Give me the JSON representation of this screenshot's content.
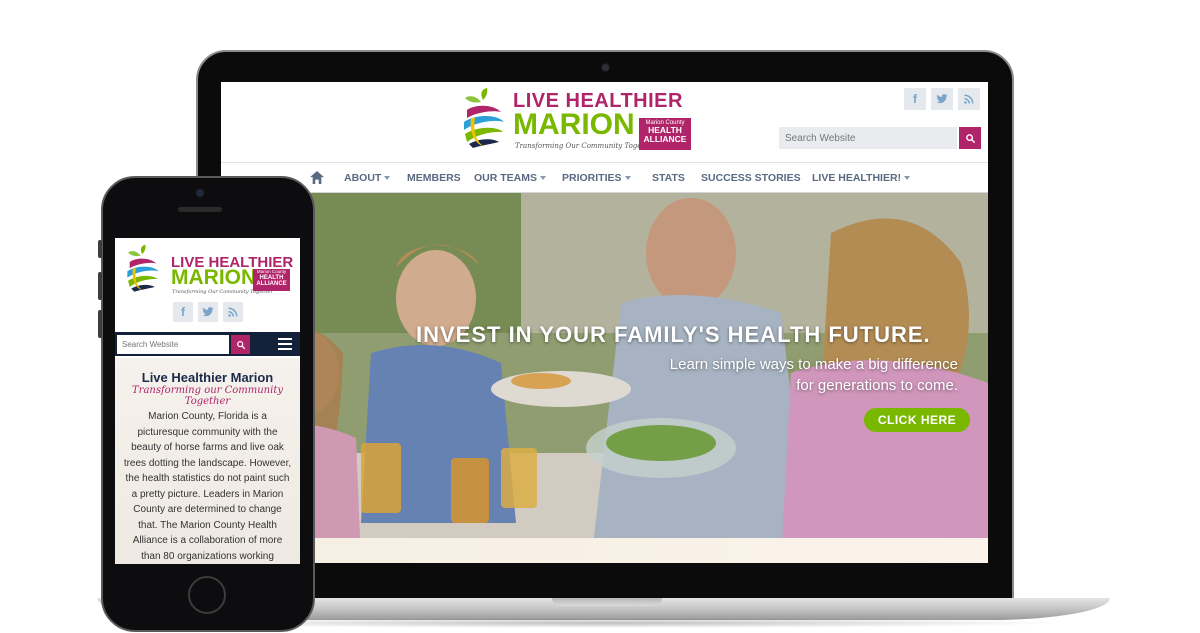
{
  "logo": {
    "line1": "LIVE HEALTHIER",
    "line2": "MARION",
    "tagline": "Transforming Our Community Together",
    "badge_small": "Marion County",
    "badge_big": "HEALTH ALLIANCE"
  },
  "social": {
    "items": [
      "facebook-icon",
      "twitter-icon",
      "rss-icon"
    ]
  },
  "search": {
    "placeholder": "Search Website"
  },
  "nav": {
    "items": [
      {
        "label": "ABOUT",
        "dropdown": true
      },
      {
        "label": "MEMBERS",
        "dropdown": false
      },
      {
        "label": "OUR TEAMS",
        "dropdown": true
      },
      {
        "label": "PRIORITIES",
        "dropdown": true
      },
      {
        "label": "STATS",
        "dropdown": false
      },
      {
        "label": "SUCCESS STORIES",
        "dropdown": false
      },
      {
        "label": "LIVE HEALTHIER!",
        "dropdown": true
      }
    ]
  },
  "hero": {
    "title": "INVEST IN YOUR FAMILY'S HEALTH FUTURE.",
    "subtitle_line1": "Learn simple ways to make a big difference",
    "subtitle_line2": "for generations to come.",
    "cta": "CLICK HERE"
  },
  "mobile": {
    "title": "Live Healthier Marion",
    "tagline": "Transforming our Community Together",
    "body": "Marion County, Florida is a picturesque community with the beauty of horse farms and live oak trees dotting the landscape. However, the health statistics do not paint such a pretty picture. Leaders in Marion County are determined to change that. The Marion County Health Alliance is a collaboration of more than 80 organizations working"
  },
  "colors": {
    "brand_magenta": "#b0246a",
    "brand_green": "#7ab800",
    "nav_text": "#5a6a82",
    "mobile_bar": "#14213a"
  }
}
